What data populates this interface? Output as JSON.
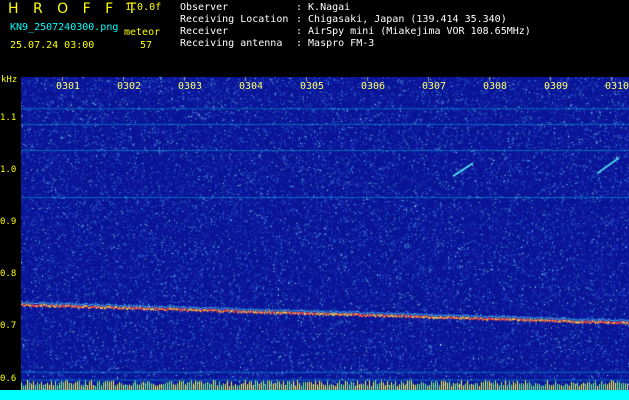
{
  "header": {
    "title": "H R O F F T",
    "version": "1.0.0f",
    "filename": "KN9_2507240300.png",
    "datetime": "25.07.24 03:00",
    "counter_label": "meteor",
    "counter_value": "57",
    "observer_label": "Observer",
    "observer_value": ": K.Nagai",
    "location_label": "Receiving Location",
    "location_value": ": Chigasaki, Japan (139.414 35.340)",
    "receiver_label": "Receiver",
    "receiver_value": ": AirSpy mini (Miakejima VOR 108.65MHz)",
    "antenna_label": "Receiving antenna",
    "antenna_value": ": Maspro FM-3"
  },
  "chart_data": {
    "type": "heatmap",
    "ylabel": "kHz",
    "x_ticks": [
      "0301",
      "0302",
      "0303",
      "0304",
      "0305",
      "0306",
      "0307",
      "0308",
      "0309",
      "0310"
    ],
    "y_ticks": [
      "1.1",
      "1.0",
      "0.9",
      "0.8",
      "0.7",
      "0.6"
    ],
    "ylim": [
      0.58,
      1.18
    ],
    "colors": {
      "background": "#0a1496",
      "trace": "#ff4040",
      "grid": "#00ffff"
    }
  }
}
